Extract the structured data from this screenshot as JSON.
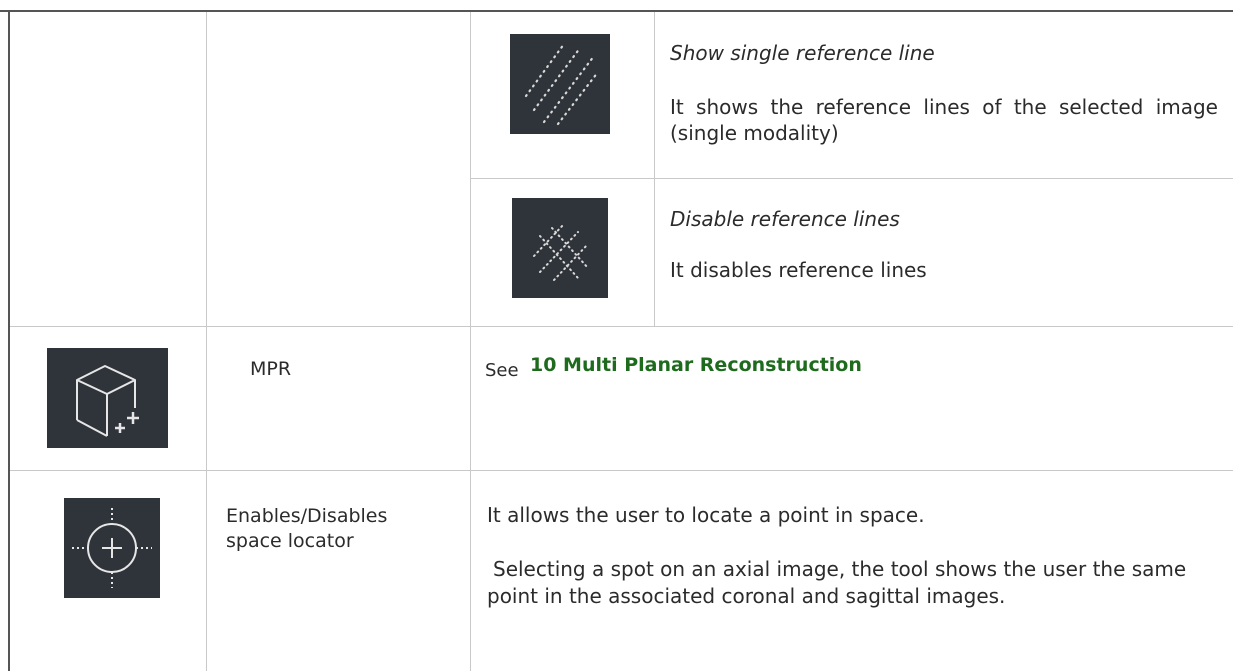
{
  "reference_lines": [
    {
      "icon": "single-reference-line-icon",
      "title": "Show single reference line",
      "description": "It shows the reference lines of the selected image (single modality)"
    },
    {
      "icon": "disable-reference-lines-icon",
      "title": "Disable reference lines",
      "description": "It disables reference lines"
    }
  ],
  "mpr": {
    "icon": "mpr-cube-icon",
    "name": "MPR",
    "see_prefix": "See",
    "link_text": "10 Multi Planar Reconstruction"
  },
  "space_locator": {
    "icon": "space-locator-icon",
    "name": "Enables/Disables space locator",
    "description_1": "It allows the user to locate a point in space.",
    "description_2": "Selecting a spot on an axial image, the tool shows the user the same point in the associated coronal and sagittal images."
  },
  "colors": {
    "icon_bg": "#2f333a",
    "link": "#1e6b1e"
  }
}
